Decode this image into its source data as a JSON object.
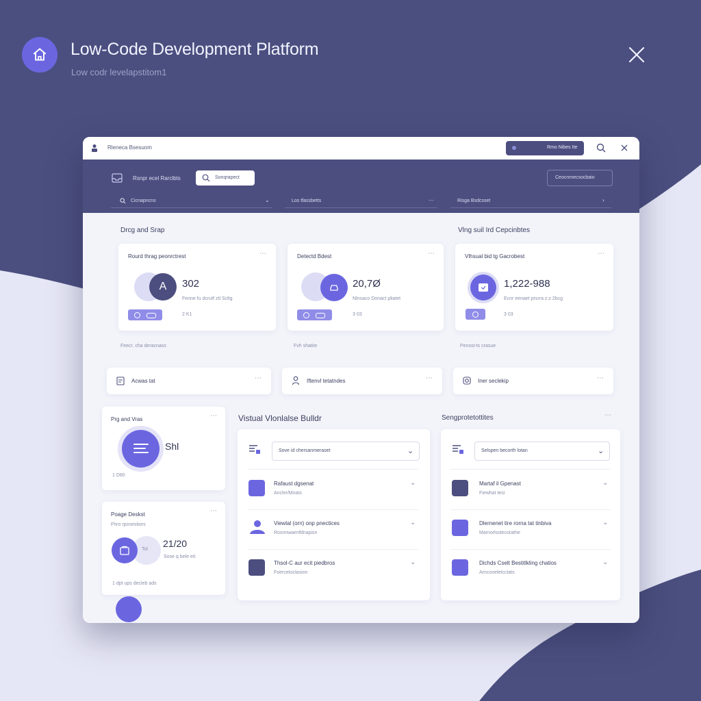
{
  "header": {
    "title": "Low-Code Development Platform",
    "subtitle": "Low codr levelapstitom1"
  },
  "window": {
    "titlebar": {
      "app_label": "Rleneca Bsesuom",
      "pill_label": "Rmo Nibes Ite"
    },
    "nav": {
      "label": "Rsnpr ecel Rarclbts",
      "search_text": "Sonqrapect",
      "right_button": "Ceocnmecsocbaio",
      "tabs": [
        {
          "label": "Cicnapncns"
        },
        {
          "label": "Los tfassbetts"
        },
        {
          "label": "Risga Bsdcsset"
        }
      ]
    },
    "sections": {
      "left_title": "Drcg and Srap",
      "right_title": "Vlng suil Ird Cepcinbtes"
    },
    "stat_cards": [
      {
        "title": "Rourd thrag peonrctrest",
        "value": "302",
        "desc": "Fenne fu dcrutf ztl Scltg",
        "meta": "2 K1",
        "avatar": "A",
        "footer": "Feecr. cha deracnass"
      },
      {
        "title": "Detectd Bdest",
        "value": "20,7Ø",
        "desc": "Nlnsaco Donact pliatet",
        "meta": "3 03",
        "footer": "Fvh shatite"
      },
      {
        "title": "Vlhsual bid tg Gacrobest",
        "value": "1,222-988",
        "desc": "Ecnr eenaet prsrra z:z 2bcg",
        "meta": "3 03",
        "footer": "Pensst-ts crasue"
      }
    ],
    "mini_cards": [
      {
        "label": "Acwas tat"
      },
      {
        "label": "Iftenvl tetatndes"
      },
      {
        "label": "Iner seclekip"
      }
    ],
    "side_cards": [
      {
        "title": "Prg and Vras",
        "value": "Shl",
        "meta": "1 D80"
      },
      {
        "title": "Poage Deskst",
        "subtitle": "Fhro rposestiors",
        "mid": "Tol",
        "value": "21/20",
        "desc": "Sose q bele eit",
        "footer": "1 dpt ups decleb ads"
      }
    ],
    "builder": {
      "title": "Vistual Vlonlalse Bulldr",
      "select_value": "Sove id chersanmeraset",
      "items": [
        {
          "title": "Rafaust dgsenat",
          "subtitle": "Ancler/Mnats"
        },
        {
          "title": "Viewlal (orn) onp pnectices",
          "subtitle": "Rosnnwaenfdnapisn"
        },
        {
          "title": "Thsol-C aur ecit piedbros",
          "subtitle": "Foercetoclasion"
        }
      ]
    },
    "settings": {
      "title": "Sengprotetottites",
      "select_value": "Selspen becorth lotan",
      "items": [
        {
          "title": "Martaf il Gpenast",
          "subtitle": "Fiewhat tesi"
        },
        {
          "title": "Dlernenet tire rorna tat tinbiva",
          "subtitle": "Marnorlsstecorathe"
        },
        {
          "title": "Dichds Cselt Bestitlkling chatios",
          "subtitle": "Arnconeletcctats"
        }
      ]
    }
  },
  "colors": {
    "accent": "#6b66e0",
    "nav_bg": "#4c4e7f",
    "page_bg": "#4b4f7f",
    "light_bg": "#f3f4fa"
  }
}
